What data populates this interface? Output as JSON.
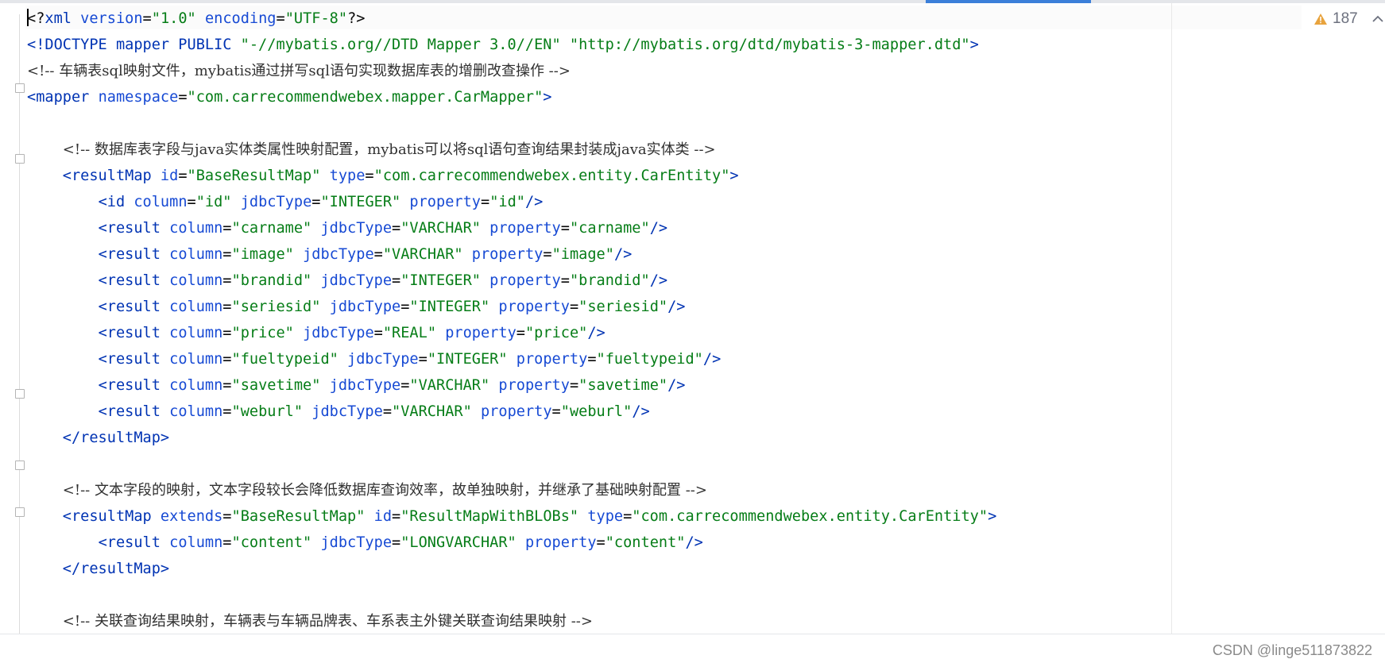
{
  "inspection": {
    "warning_count": "187"
  },
  "watermark": "CSDN @linge511873822",
  "code_lines": [
    [
      [
        "p",
        "<?"
      ],
      [
        "t",
        "xml "
      ],
      [
        "a",
        "version"
      ],
      [
        "p",
        "="
      ],
      [
        "s",
        "\"1.0\""
      ],
      [
        "p",
        " "
      ],
      [
        "a",
        "encoding"
      ],
      [
        "p",
        "="
      ],
      [
        "s",
        "\"UTF-8\""
      ],
      [
        "p",
        "?>"
      ]
    ],
    [
      [
        "t",
        "<!DOCTYPE mapper PUBLIC "
      ],
      [
        "s",
        "\"-//mybatis.org//DTD Mapper 3.0//EN\""
      ],
      [
        "p",
        " "
      ],
      [
        "s",
        "\"http://mybatis.org/dtd/mybatis-3-mapper.dtd\""
      ],
      [
        "t",
        ">"
      ]
    ],
    [
      [
        "c",
        "<!-- 车辆表sql映射文件，mybatis通过拼写sql语句实现数据库表的增删改查操作 -->"
      ]
    ],
    [
      [
        "t",
        "<mapper "
      ],
      [
        "a",
        "namespace"
      ],
      [
        "p",
        "="
      ],
      [
        "s",
        "\"com.carrecommendwebex.mapper.CarMapper\""
      ],
      [
        "t",
        ">"
      ]
    ],
    [],
    [
      [
        "p",
        "    "
      ],
      [
        "c",
        "<!-- 数据库表字段与java实体类属性映射配置，mybatis可以将sql语句查询结果封装成java实体类 -->"
      ]
    ],
    [
      [
        "p",
        "    "
      ],
      [
        "t",
        "<resultMap "
      ],
      [
        "a",
        "id"
      ],
      [
        "p",
        "="
      ],
      [
        "s",
        "\"BaseResultMap\""
      ],
      [
        "p",
        " "
      ],
      [
        "a",
        "type"
      ],
      [
        "p",
        "="
      ],
      [
        "s",
        "\"com.carrecommendwebex.entity.CarEntity\""
      ],
      [
        "t",
        ">"
      ]
    ],
    [
      [
        "p",
        "        "
      ],
      [
        "t",
        "<id "
      ],
      [
        "a",
        "column"
      ],
      [
        "p",
        "="
      ],
      [
        "s",
        "\"id\""
      ],
      [
        "p",
        " "
      ],
      [
        "a",
        "jdbcType"
      ],
      [
        "p",
        "="
      ],
      [
        "s",
        "\"INTEGER\""
      ],
      [
        "p",
        " "
      ],
      [
        "a",
        "property"
      ],
      [
        "p",
        "="
      ],
      [
        "s",
        "\"id\""
      ],
      [
        "t",
        "/>"
      ]
    ],
    [
      [
        "p",
        "        "
      ],
      [
        "t",
        "<result "
      ],
      [
        "a",
        "column"
      ],
      [
        "p",
        "="
      ],
      [
        "s",
        "\"carname\""
      ],
      [
        "p",
        " "
      ],
      [
        "a",
        "jdbcType"
      ],
      [
        "p",
        "="
      ],
      [
        "s",
        "\"VARCHAR\""
      ],
      [
        "p",
        " "
      ],
      [
        "a",
        "property"
      ],
      [
        "p",
        "="
      ],
      [
        "s",
        "\"carname\""
      ],
      [
        "t",
        "/>"
      ]
    ],
    [
      [
        "p",
        "        "
      ],
      [
        "t",
        "<result "
      ],
      [
        "a",
        "column"
      ],
      [
        "p",
        "="
      ],
      [
        "s",
        "\"image\""
      ],
      [
        "p",
        " "
      ],
      [
        "a",
        "jdbcType"
      ],
      [
        "p",
        "="
      ],
      [
        "s",
        "\"VARCHAR\""
      ],
      [
        "p",
        " "
      ],
      [
        "a",
        "property"
      ],
      [
        "p",
        "="
      ],
      [
        "s",
        "\"image\""
      ],
      [
        "t",
        "/>"
      ]
    ],
    [
      [
        "p",
        "        "
      ],
      [
        "t",
        "<result "
      ],
      [
        "a",
        "column"
      ],
      [
        "p",
        "="
      ],
      [
        "s",
        "\"brandid\""
      ],
      [
        "p",
        " "
      ],
      [
        "a",
        "jdbcType"
      ],
      [
        "p",
        "="
      ],
      [
        "s",
        "\"INTEGER\""
      ],
      [
        "p",
        " "
      ],
      [
        "a",
        "property"
      ],
      [
        "p",
        "="
      ],
      [
        "s",
        "\"brandid\""
      ],
      [
        "t",
        "/>"
      ]
    ],
    [
      [
        "p",
        "        "
      ],
      [
        "t",
        "<result "
      ],
      [
        "a",
        "column"
      ],
      [
        "p",
        "="
      ],
      [
        "s",
        "\"seriesid\""
      ],
      [
        "p",
        " "
      ],
      [
        "a",
        "jdbcType"
      ],
      [
        "p",
        "="
      ],
      [
        "s",
        "\"INTEGER\""
      ],
      [
        "p",
        " "
      ],
      [
        "a",
        "property"
      ],
      [
        "p",
        "="
      ],
      [
        "s",
        "\"seriesid\""
      ],
      [
        "t",
        "/>"
      ]
    ],
    [
      [
        "p",
        "        "
      ],
      [
        "t",
        "<result "
      ],
      [
        "a",
        "column"
      ],
      [
        "p",
        "="
      ],
      [
        "s",
        "\"price\""
      ],
      [
        "p",
        " "
      ],
      [
        "a",
        "jdbcType"
      ],
      [
        "p",
        "="
      ],
      [
        "s",
        "\"REAL\""
      ],
      [
        "p",
        " "
      ],
      [
        "a",
        "property"
      ],
      [
        "p",
        "="
      ],
      [
        "s",
        "\"price\""
      ],
      [
        "t",
        "/>"
      ]
    ],
    [
      [
        "p",
        "        "
      ],
      [
        "t",
        "<result "
      ],
      [
        "a",
        "column"
      ],
      [
        "p",
        "="
      ],
      [
        "s",
        "\"fueltypeid\""
      ],
      [
        "p",
        " "
      ],
      [
        "a",
        "jdbcType"
      ],
      [
        "p",
        "="
      ],
      [
        "s",
        "\"INTEGER\""
      ],
      [
        "p",
        " "
      ],
      [
        "a",
        "property"
      ],
      [
        "p",
        "="
      ],
      [
        "s",
        "\"fueltypeid\""
      ],
      [
        "t",
        "/>"
      ]
    ],
    [
      [
        "p",
        "        "
      ],
      [
        "t",
        "<result "
      ],
      [
        "a",
        "column"
      ],
      [
        "p",
        "="
      ],
      [
        "s",
        "\"savetime\""
      ],
      [
        "p",
        " "
      ],
      [
        "a",
        "jdbcType"
      ],
      [
        "p",
        "="
      ],
      [
        "s",
        "\"VARCHAR\""
      ],
      [
        "p",
        " "
      ],
      [
        "a",
        "property"
      ],
      [
        "p",
        "="
      ],
      [
        "s",
        "\"savetime\""
      ],
      [
        "t",
        "/>"
      ]
    ],
    [
      [
        "p",
        "        "
      ],
      [
        "t",
        "<result "
      ],
      [
        "a",
        "column"
      ],
      [
        "p",
        "="
      ],
      [
        "s",
        "\"weburl\""
      ],
      [
        "p",
        " "
      ],
      [
        "a",
        "jdbcType"
      ],
      [
        "p",
        "="
      ],
      [
        "s",
        "\"VARCHAR\""
      ],
      [
        "p",
        " "
      ],
      [
        "a",
        "property"
      ],
      [
        "p",
        "="
      ],
      [
        "s",
        "\"weburl\""
      ],
      [
        "t",
        "/>"
      ]
    ],
    [
      [
        "p",
        "    "
      ],
      [
        "t",
        "</resultMap>"
      ]
    ],
    [],
    [
      [
        "p",
        "    "
      ],
      [
        "c",
        "<!-- 文本字段的映射，文本字段较长会降低数据库查询效率，故单独映射，并继承了基础映射配置 -->"
      ]
    ],
    [
      [
        "p",
        "    "
      ],
      [
        "t",
        "<resultMap "
      ],
      [
        "a",
        "extends"
      ],
      [
        "p",
        "="
      ],
      [
        "s",
        "\"BaseResultMap\""
      ],
      [
        "p",
        " "
      ],
      [
        "a",
        "id"
      ],
      [
        "p",
        "="
      ],
      [
        "s",
        "\"ResultMapWithBLOBs\""
      ],
      [
        "p",
        " "
      ],
      [
        "a",
        "type"
      ],
      [
        "p",
        "="
      ],
      [
        "s",
        "\"com.carrecommendwebex.entity.CarEntity\""
      ],
      [
        "t",
        ">"
      ]
    ],
    [
      [
        "p",
        "        "
      ],
      [
        "t",
        "<result "
      ],
      [
        "a",
        "column"
      ],
      [
        "p",
        "="
      ],
      [
        "s",
        "\"content\""
      ],
      [
        "p",
        " "
      ],
      [
        "a",
        "jdbcType"
      ],
      [
        "p",
        "="
      ],
      [
        "s",
        "\"LONGVARCHAR\""
      ],
      [
        "p",
        " "
      ],
      [
        "a",
        "property"
      ],
      [
        "p",
        "="
      ],
      [
        "s",
        "\"content\""
      ],
      [
        "t",
        "/>"
      ]
    ],
    [
      [
        "p",
        "    "
      ],
      [
        "t",
        "</resultMap>"
      ]
    ],
    [],
    [
      [
        "p",
        "    "
      ],
      [
        "c",
        "<!-- 关联查询结果映射，车辆表与车辆品牌表、车系表主外键关联查询结果映射 -->"
      ]
    ]
  ],
  "colors": {
    "tag": "#0033b3",
    "attribute": "#174ad4",
    "string": "#067d17",
    "comment": "#303030",
    "accent": "#3b7fd9",
    "warning": "#e8a33d"
  }
}
